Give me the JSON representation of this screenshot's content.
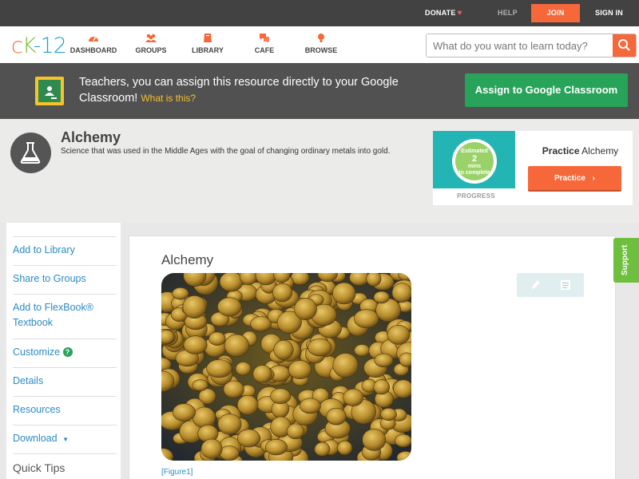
{
  "topbar": {
    "donate": "DONATE",
    "help": "HELP",
    "join": "JOIN",
    "sign_in": "SIGN IN"
  },
  "nav": {
    "logo": {
      "c": "c",
      "k": "K",
      "n": "-12"
    },
    "items": [
      {
        "label": "DASHBOARD",
        "icon": "dashboard-icon"
      },
      {
        "label": "GROUPS",
        "icon": "groups-icon"
      },
      {
        "label": "LIBRARY",
        "icon": "library-icon"
      },
      {
        "label": "CAFE",
        "icon": "cafe-icon"
      },
      {
        "label": "BROWSE",
        "icon": "browse-icon"
      }
    ],
    "search_placeholder": "What do you want to learn today?"
  },
  "banner": {
    "text": "Teachers, you can assign this resource directly to your Google Classroom!",
    "link": "What is this?",
    "button": "Assign to Google Classroom"
  },
  "concept": {
    "title": "Alchemy",
    "description": "Science that was used in the Middle Ages with the goal of changing ordinary metals into gold.",
    "progress": {
      "line1": "Estimated",
      "minutes": "2",
      "line3": "mins",
      "line4": "to complete",
      "label": "PROGRESS"
    },
    "practice": {
      "title_bold": "Practice",
      "title_rest": "Alchemy",
      "button": "Practice"
    }
  },
  "sidebar": {
    "items": [
      "Add to Library",
      "Share to Groups",
      "Add to FlexBook® Textbook",
      "Customize",
      "Details",
      "Resources",
      "Download"
    ],
    "quick_tips": "Quick Tips"
  },
  "main": {
    "title": "Alchemy",
    "figure_link": "[Figure1]"
  },
  "support": "Support",
  "colors": {
    "accent": "#f6683a",
    "link": "#2b8bc7",
    "green": "#27a35a",
    "banner": "#515151",
    "topbar": "#424242"
  }
}
